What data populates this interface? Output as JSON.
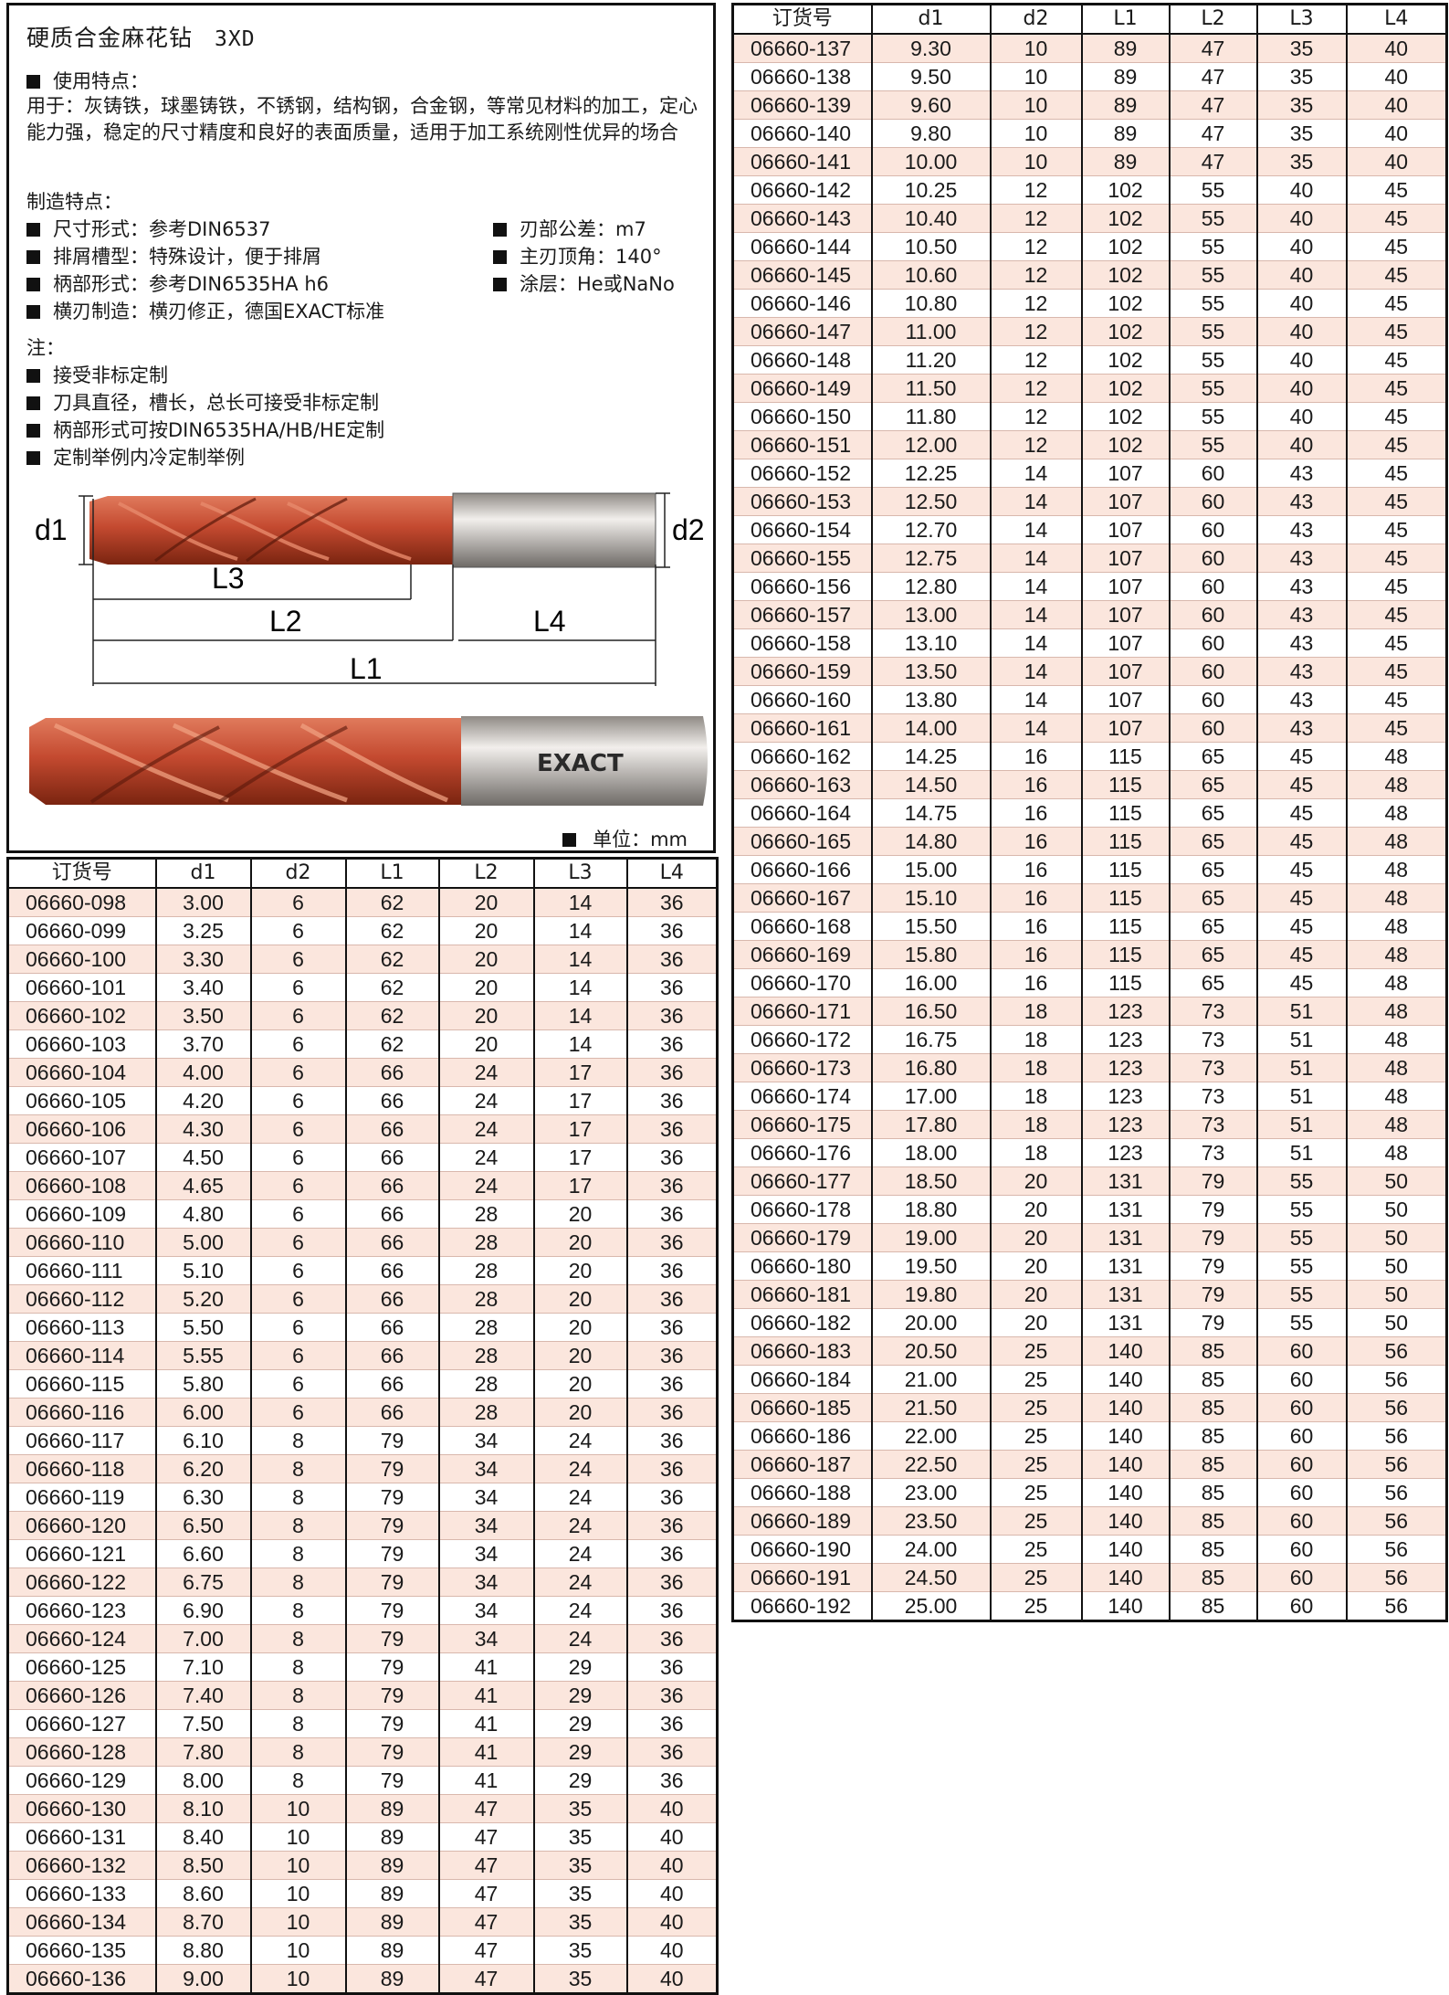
{
  "title": "硬质合金麻花钻",
  "subtitle": "3XD",
  "usage": {
    "heading": "使用特点：",
    "text": "用于：灰铸铁，球墨铸铁，不锈钢，结构钢，合金钢，等常见材料的加工，定心能力强，稳定的尺寸精度和良好的表面质量，适用于加工系统刚性优异的场合"
  },
  "manufacturing": {
    "heading": "制造特点：",
    "left": [
      "尺寸形式：参考DIN6537",
      "排屑槽型：特殊设计，便于排屑",
      "柄部形式：参考DIN6535HA h6",
      "横刃制造：横刃修正，德国EXACT标准"
    ],
    "right": [
      "刃部公差：m7",
      "主刃顶角：140°",
      "涂层：He或NaNo"
    ]
  },
  "notes": {
    "heading": "注：",
    "items": [
      "接受非标定制",
      "刀具直径，槽长，总长可接受非标定制",
      "柄部形式可按DIN6535HA/HB/HE定制",
      "定制举例内冷定制举例"
    ]
  },
  "diagram_labels": {
    "d1": "d1",
    "d2": "d2",
    "l1": "L1",
    "l2": "L2",
    "l3": "L3",
    "l4": "L4"
  },
  "brand_logo": "EXACT",
  "unit_label": "单位：mm",
  "colors": {
    "drill_red": "#c44a30",
    "row_tint": "#fbe6dd",
    "shank": "#c9c5c0"
  },
  "table_headers": [
    "订货号",
    "d1",
    "d2",
    "L1",
    "L2",
    "L3",
    "L4"
  ],
  "table_left_rows": [
    [
      "06660-098",
      "3.00",
      "6",
      "62",
      "20",
      "14",
      "36"
    ],
    [
      "06660-099",
      "3.25",
      "6",
      "62",
      "20",
      "14",
      "36"
    ],
    [
      "06660-100",
      "3.30",
      "6",
      "62",
      "20",
      "14",
      "36"
    ],
    [
      "06660-101",
      "3.40",
      "6",
      "62",
      "20",
      "14",
      "36"
    ],
    [
      "06660-102",
      "3.50",
      "6",
      "62",
      "20",
      "14",
      "36"
    ],
    [
      "06660-103",
      "3.70",
      "6",
      "62",
      "20",
      "14",
      "36"
    ],
    [
      "06660-104",
      "4.00",
      "6",
      "66",
      "24",
      "17",
      "36"
    ],
    [
      "06660-105",
      "4.20",
      "6",
      "66",
      "24",
      "17",
      "36"
    ],
    [
      "06660-106",
      "4.30",
      "6",
      "66",
      "24",
      "17",
      "36"
    ],
    [
      "06660-107",
      "4.50",
      "6",
      "66",
      "24",
      "17",
      "36"
    ],
    [
      "06660-108",
      "4.65",
      "6",
      "66",
      "24",
      "17",
      "36"
    ],
    [
      "06660-109",
      "4.80",
      "6",
      "66",
      "28",
      "20",
      "36"
    ],
    [
      "06660-110",
      "5.00",
      "6",
      "66",
      "28",
      "20",
      "36"
    ],
    [
      "06660-111",
      "5.10",
      "6",
      "66",
      "28",
      "20",
      "36"
    ],
    [
      "06660-112",
      "5.20",
      "6",
      "66",
      "28",
      "20",
      "36"
    ],
    [
      "06660-113",
      "5.50",
      "6",
      "66",
      "28",
      "20",
      "36"
    ],
    [
      "06660-114",
      "5.55",
      "6",
      "66",
      "28",
      "20",
      "36"
    ],
    [
      "06660-115",
      "5.80",
      "6",
      "66",
      "28",
      "20",
      "36"
    ],
    [
      "06660-116",
      "6.00",
      "6",
      "66",
      "28",
      "20",
      "36"
    ],
    [
      "06660-117",
      "6.10",
      "8",
      "79",
      "34",
      "24",
      "36"
    ],
    [
      "06660-118",
      "6.20",
      "8",
      "79",
      "34",
      "24",
      "36"
    ],
    [
      "06660-119",
      "6.30",
      "8",
      "79",
      "34",
      "24",
      "36"
    ],
    [
      "06660-120",
      "6.50",
      "8",
      "79",
      "34",
      "24",
      "36"
    ],
    [
      "06660-121",
      "6.60",
      "8",
      "79",
      "34",
      "24",
      "36"
    ],
    [
      "06660-122",
      "6.75",
      "8",
      "79",
      "34",
      "24",
      "36"
    ],
    [
      "06660-123",
      "6.90",
      "8",
      "79",
      "34",
      "24",
      "36"
    ],
    [
      "06660-124",
      "7.00",
      "8",
      "79",
      "34",
      "24",
      "36"
    ],
    [
      "06660-125",
      "7.10",
      "8",
      "79",
      "41",
      "29",
      "36"
    ],
    [
      "06660-126",
      "7.40",
      "8",
      "79",
      "41",
      "29",
      "36"
    ],
    [
      "06660-127",
      "7.50",
      "8",
      "79",
      "41",
      "29",
      "36"
    ],
    [
      "06660-128",
      "7.80",
      "8",
      "79",
      "41",
      "29",
      "36"
    ],
    [
      "06660-129",
      "8.00",
      "8",
      "79",
      "41",
      "29",
      "36"
    ],
    [
      "06660-130",
      "8.10",
      "10",
      "89",
      "47",
      "35",
      "40"
    ],
    [
      "06660-131",
      "8.40",
      "10",
      "89",
      "47",
      "35",
      "40"
    ],
    [
      "06660-132",
      "8.50",
      "10",
      "89",
      "47",
      "35",
      "40"
    ],
    [
      "06660-133",
      "8.60",
      "10",
      "89",
      "47",
      "35",
      "40"
    ],
    [
      "06660-134",
      "8.70",
      "10",
      "89",
      "47",
      "35",
      "40"
    ],
    [
      "06660-135",
      "8.80",
      "10",
      "89",
      "47",
      "35",
      "40"
    ],
    [
      "06660-136",
      "9.00",
      "10",
      "89",
      "47",
      "35",
      "40"
    ]
  ],
  "table_right_rows": [
    [
      "06660-137",
      "9.30",
      "10",
      "89",
      "47",
      "35",
      "40"
    ],
    [
      "06660-138",
      "9.50",
      "10",
      "89",
      "47",
      "35",
      "40"
    ],
    [
      "06660-139",
      "9.60",
      "10",
      "89",
      "47",
      "35",
      "40"
    ],
    [
      "06660-140",
      "9.80",
      "10",
      "89",
      "47",
      "35",
      "40"
    ],
    [
      "06660-141",
      "10.00",
      "10",
      "89",
      "47",
      "35",
      "40"
    ],
    [
      "06660-142",
      "10.25",
      "12",
      "102",
      "55",
      "40",
      "45"
    ],
    [
      "06660-143",
      "10.40",
      "12",
      "102",
      "55",
      "40",
      "45"
    ],
    [
      "06660-144",
      "10.50",
      "12",
      "102",
      "55",
      "40",
      "45"
    ],
    [
      "06660-145",
      "10.60",
      "12",
      "102",
      "55",
      "40",
      "45"
    ],
    [
      "06660-146",
      "10.80",
      "12",
      "102",
      "55",
      "40",
      "45"
    ],
    [
      "06660-147",
      "11.00",
      "12",
      "102",
      "55",
      "40",
      "45"
    ],
    [
      "06660-148",
      "11.20",
      "12",
      "102",
      "55",
      "40",
      "45"
    ],
    [
      "06660-149",
      "11.50",
      "12",
      "102",
      "55",
      "40",
      "45"
    ],
    [
      "06660-150",
      "11.80",
      "12",
      "102",
      "55",
      "40",
      "45"
    ],
    [
      "06660-151",
      "12.00",
      "12",
      "102",
      "55",
      "40",
      "45"
    ],
    [
      "06660-152",
      "12.25",
      "14",
      "107",
      "60",
      "43",
      "45"
    ],
    [
      "06660-153",
      "12.50",
      "14",
      "107",
      "60",
      "43",
      "45"
    ],
    [
      "06660-154",
      "12.70",
      "14",
      "107",
      "60",
      "43",
      "45"
    ],
    [
      "06660-155",
      "12.75",
      "14",
      "107",
      "60",
      "43",
      "45"
    ],
    [
      "06660-156",
      "12.80",
      "14",
      "107",
      "60",
      "43",
      "45"
    ],
    [
      "06660-157",
      "13.00",
      "14",
      "107",
      "60",
      "43",
      "45"
    ],
    [
      "06660-158",
      "13.10",
      "14",
      "107",
      "60",
      "43",
      "45"
    ],
    [
      "06660-159",
      "13.50",
      "14",
      "107",
      "60",
      "43",
      "45"
    ],
    [
      "06660-160",
      "13.80",
      "14",
      "107",
      "60",
      "43",
      "45"
    ],
    [
      "06660-161",
      "14.00",
      "14",
      "107",
      "60",
      "43",
      "45"
    ],
    [
      "06660-162",
      "14.25",
      "16",
      "115",
      "65",
      "45",
      "48"
    ],
    [
      "06660-163",
      "14.50",
      "16",
      "115",
      "65",
      "45",
      "48"
    ],
    [
      "06660-164",
      "14.75",
      "16",
      "115",
      "65",
      "45",
      "48"
    ],
    [
      "06660-165",
      "14.80",
      "16",
      "115",
      "65",
      "45",
      "48"
    ],
    [
      "06660-166",
      "15.00",
      "16",
      "115",
      "65",
      "45",
      "48"
    ],
    [
      "06660-167",
      "15.10",
      "16",
      "115",
      "65",
      "45",
      "48"
    ],
    [
      "06660-168",
      "15.50",
      "16",
      "115",
      "65",
      "45",
      "48"
    ],
    [
      "06660-169",
      "15.80",
      "16",
      "115",
      "65",
      "45",
      "48"
    ],
    [
      "06660-170",
      "16.00",
      "16",
      "115",
      "65",
      "45",
      "48"
    ],
    [
      "06660-171",
      "16.50",
      "18",
      "123",
      "73",
      "51",
      "48"
    ],
    [
      "06660-172",
      "16.75",
      "18",
      "123",
      "73",
      "51",
      "48"
    ],
    [
      "06660-173",
      "16.80",
      "18",
      "123",
      "73",
      "51",
      "48"
    ],
    [
      "06660-174",
      "17.00",
      "18",
      "123",
      "73",
      "51",
      "48"
    ],
    [
      "06660-175",
      "17.80",
      "18",
      "123",
      "73",
      "51",
      "48"
    ],
    [
      "06660-176",
      "18.00",
      "18",
      "123",
      "73",
      "51",
      "48"
    ],
    [
      "06660-177",
      "18.50",
      "20",
      "131",
      "79",
      "55",
      "50"
    ],
    [
      "06660-178",
      "18.80",
      "20",
      "131",
      "79",
      "55",
      "50"
    ],
    [
      "06660-179",
      "19.00",
      "20",
      "131",
      "79",
      "55",
      "50"
    ],
    [
      "06660-180",
      "19.50",
      "20",
      "131",
      "79",
      "55",
      "50"
    ],
    [
      "06660-181",
      "19.80",
      "20",
      "131",
      "79",
      "55",
      "50"
    ],
    [
      "06660-182",
      "20.00",
      "20",
      "131",
      "79",
      "55",
      "50"
    ],
    [
      "06660-183",
      "20.50",
      "25",
      "140",
      "85",
      "60",
      "56"
    ],
    [
      "06660-184",
      "21.00",
      "25",
      "140",
      "85",
      "60",
      "56"
    ],
    [
      "06660-185",
      "21.50",
      "25",
      "140",
      "85",
      "60",
      "56"
    ],
    [
      "06660-186",
      "22.00",
      "25",
      "140",
      "85",
      "60",
      "56"
    ],
    [
      "06660-187",
      "22.50",
      "25",
      "140",
      "85",
      "60",
      "56"
    ],
    [
      "06660-188",
      "23.00",
      "25",
      "140",
      "85",
      "60",
      "56"
    ],
    [
      "06660-189",
      "23.50",
      "25",
      "140",
      "85",
      "60",
      "56"
    ],
    [
      "06660-190",
      "24.00",
      "25",
      "140",
      "85",
      "60",
      "56"
    ],
    [
      "06660-191",
      "24.50",
      "25",
      "140",
      "85",
      "60",
      "56"
    ],
    [
      "06660-192",
      "25.00",
      "25",
      "140",
      "85",
      "60",
      "56"
    ]
  ]
}
